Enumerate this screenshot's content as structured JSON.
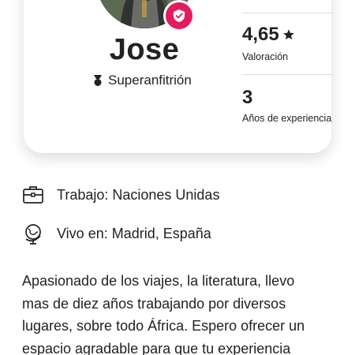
{
  "host": {
    "name": "Jose",
    "superhost_label": "Superanfitrión",
    "verified_icon": "shield-check-icon"
  },
  "stats": {
    "rating": {
      "value": "4,65",
      "icon": "star-icon",
      "label": "Valoración"
    },
    "experience": {
      "value": "3",
      "label": "Años de experiencia"
    }
  },
  "details": {
    "work": {
      "icon": "briefcase-icon",
      "text": "Trabajo: Naciones Unidas"
    },
    "location": {
      "icon": "globe-icon",
      "text": "Vivo en: Madrid, España"
    }
  },
  "bio": {
    "lines": [
      "Apasionado de los viajes, la literatura, llevo",
      "mas de diez años trabajando por diversos",
      "lugares, sobre todo África. Espero ofrecer un",
      "espacio agradable para que tu experiencia"
    ]
  },
  "colors": {
    "accent": "#e31c5f",
    "text": "#222222",
    "divider": "#dddddd"
  }
}
